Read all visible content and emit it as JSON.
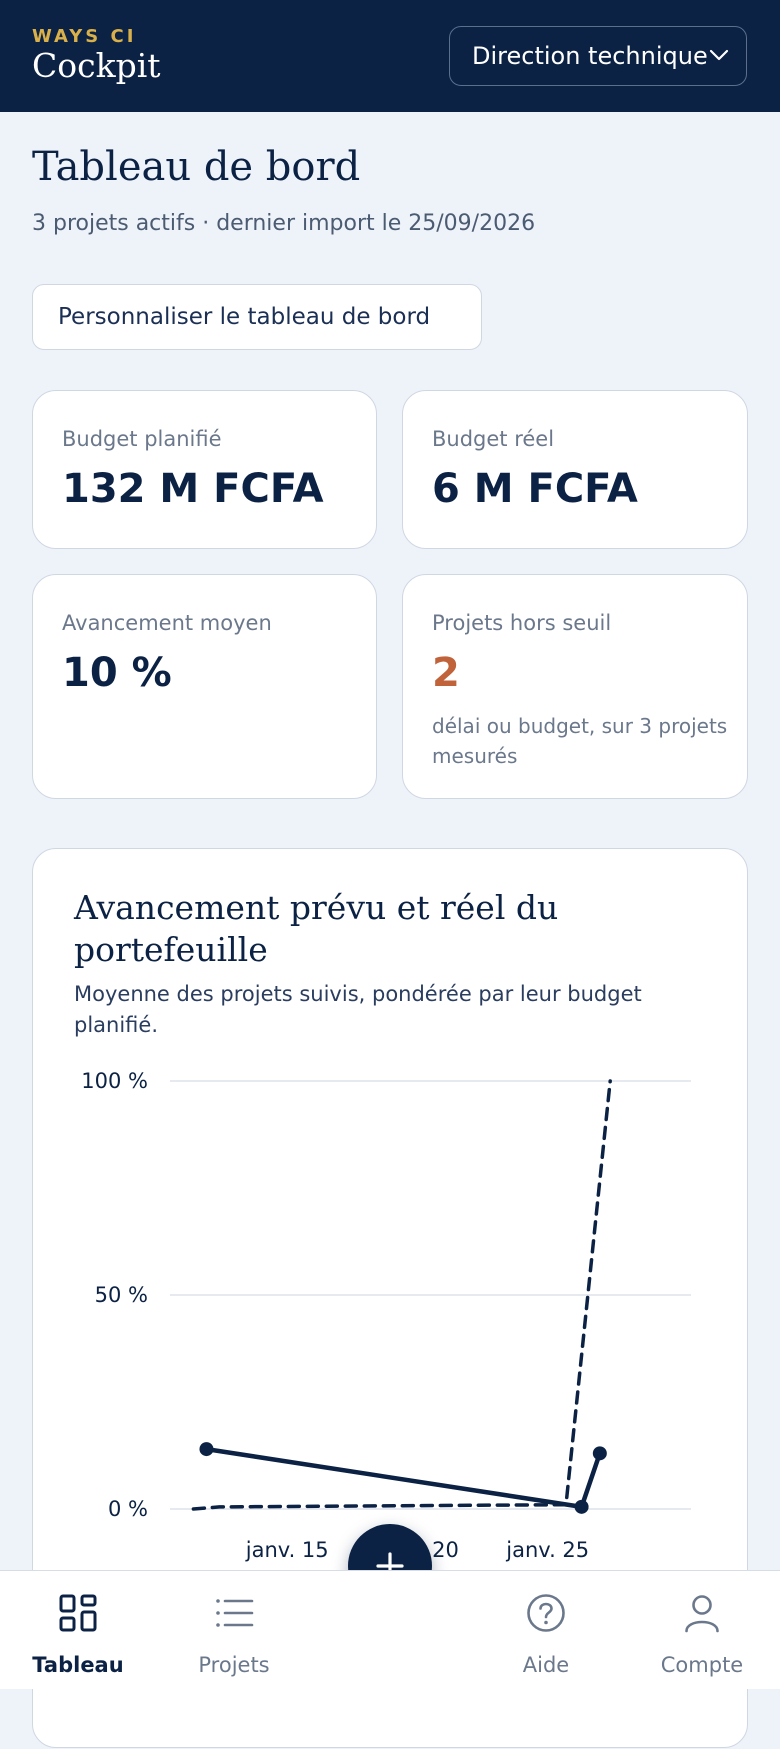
{
  "header": {
    "brand_top": "WAYS CI",
    "brand_name": "Cockpit",
    "scope_selected": "Direction technique"
  },
  "page": {
    "title": "Tableau de bord",
    "subtitle": "3 projets actifs · dernier import le 25/09/2026",
    "customize_label": "Personnaliser le tableau de bord"
  },
  "kpis": [
    {
      "label": "Budget planifié",
      "value": "132 M FCFA"
    },
    {
      "label": "Budget réel",
      "value": "6 M FCFA"
    },
    {
      "label": "Avancement moyen",
      "value": "10 %"
    },
    {
      "label": "Projets hors seuil",
      "value": "2",
      "note": "délai ou budget, sur 3 projets mesurés",
      "value_color": "#c0623a"
    }
  ],
  "chart": {
    "title": "Avancement prévu et réel du portefeuille",
    "subtitle": "Moyenne des projets suivis, pondérée par leur budget planifié."
  },
  "chart_data": {
    "type": "line",
    "title": "Avancement prévu et réel du portefeuille",
    "y_ticks": [
      "100 %",
      "50 %",
      "0 %"
    ],
    "x_ticks": [
      "janv. 15",
      "janv. 20",
      "janv. 25"
    ],
    "ylim": [
      0,
      100
    ],
    "x_range_days": [
      10.5,
      30.5
    ],
    "grid": true,
    "series": [
      {
        "style": "solid-markers",
        "points": [
          {
            "x": 11.9,
            "y": 14
          },
          {
            "x": 26.3,
            "y": 0.5
          },
          {
            "x": 27.0,
            "y": 13
          }
        ]
      },
      {
        "style": "dashed",
        "points": [
          {
            "x": 11.4,
            "y": 0
          },
          {
            "x": 12.4,
            "y": 0.5
          },
          {
            "x": 25.7,
            "y": 1
          },
          {
            "x": 27.4,
            "y": 100
          }
        ]
      }
    ],
    "colors": {
      "line": "#0c2244",
      "grid": "#dde2ea"
    }
  },
  "bottom_nav": {
    "items": [
      {
        "label": "Tableau",
        "icon": "dashboard-grid-icon",
        "active": true
      },
      {
        "label": "Projets",
        "icon": "list-icon",
        "active": false
      },
      {
        "label": "Aide",
        "icon": "help-circle-icon",
        "active": false
      },
      {
        "label": "Compte",
        "icon": "user-icon",
        "active": false
      }
    ],
    "fab_icon": "plus-icon"
  }
}
